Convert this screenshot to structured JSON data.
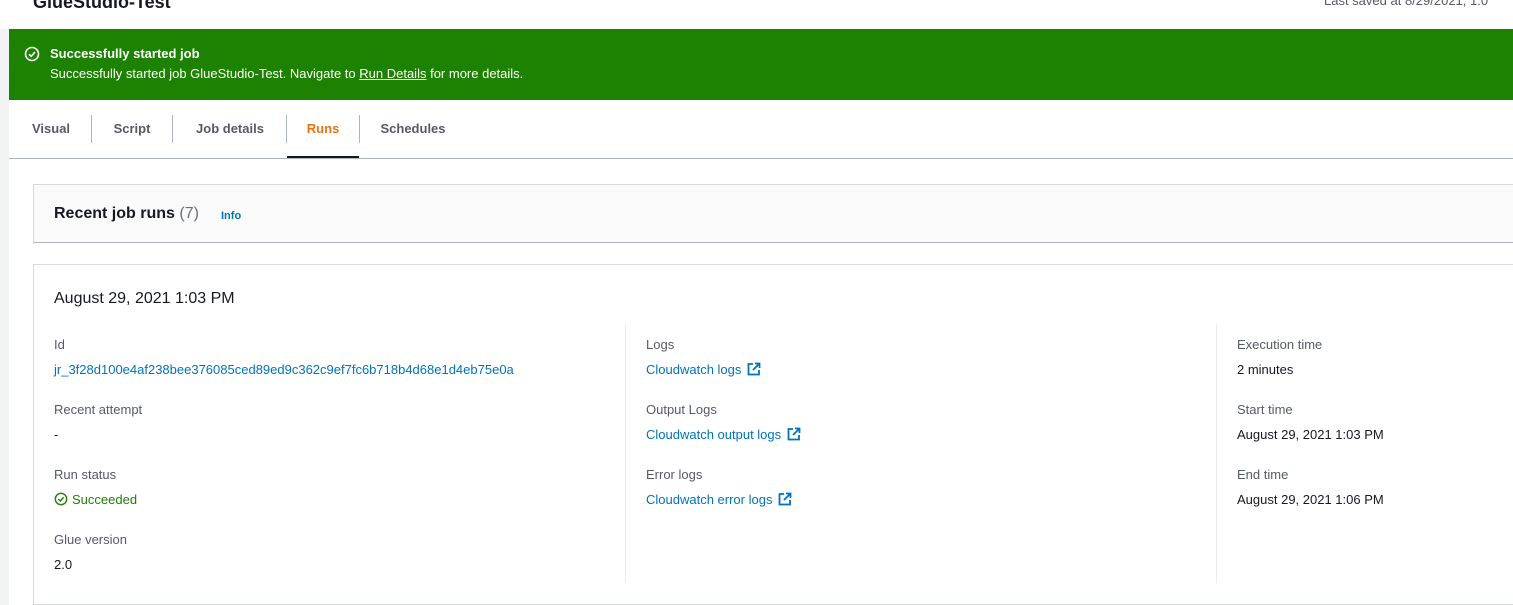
{
  "header": {
    "title": "GlueStudio-Test",
    "last_saved": "Last saved at 8/29/2021, 1:0"
  },
  "flash": {
    "title": "Successfully started job",
    "message_prefix": "Successfully started job GlueStudio-Test. Navigate to ",
    "link_text": "Run Details",
    "message_suffix": " for more details.",
    "color": "#1d8102"
  },
  "tabs": [
    {
      "label": "Visual"
    },
    {
      "label": "Script"
    },
    {
      "label": "Job details"
    },
    {
      "label": "Runs",
      "active": true
    },
    {
      "label": "Schedules"
    }
  ],
  "runs": {
    "title": "Recent job runs",
    "count": "(7)",
    "info": "Info"
  },
  "run": {
    "date": "August 29, 2021 1:03 PM",
    "id_label": "Id",
    "id_value": "jr_3f28d100e4af238bee376085ced89ed9c362c9ef7fc6b718b4d68e1d4eb75e0a",
    "recent_attempt_label": "Recent attempt",
    "recent_attempt_value": "-",
    "run_status_label": "Run status",
    "run_status_value": "Succeeded",
    "glue_version_label": "Glue version",
    "glue_version_value": "2.0",
    "logs_label": "Logs",
    "logs_link": "Cloudwatch logs",
    "output_logs_label": "Output Logs",
    "output_logs_link": "Cloudwatch output logs",
    "error_logs_label": "Error logs",
    "error_logs_link": "Cloudwatch error logs",
    "execution_time_label": "Execution time",
    "execution_time_value": "2 minutes",
    "start_time_label": "Start time",
    "start_time_value": "August 29, 2021 1:03 PM",
    "end_time_label": "End time",
    "end_time_value": "August 29, 2021 1:06 PM"
  },
  "colors": {
    "link": "#0073bb",
    "active_tab": "#ec7211",
    "success": "#1d8102"
  }
}
